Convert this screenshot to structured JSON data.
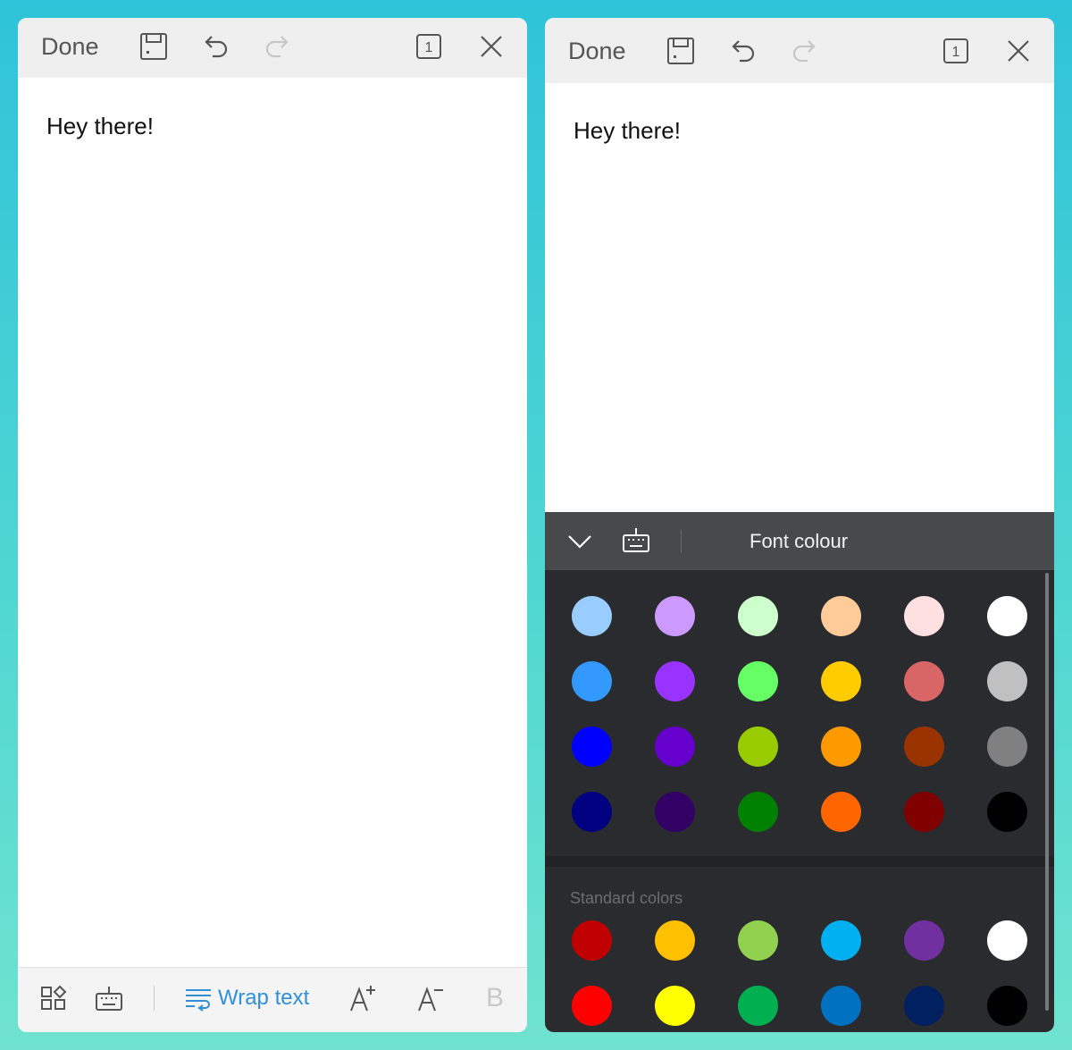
{
  "left_editor": {
    "toolbar": {
      "done_label": "Done",
      "page_number": "1"
    },
    "content_text": "Hey there!",
    "bottom_toolbar": {
      "wrap_text_label": "Wrap text",
      "bold_label": "B"
    }
  },
  "right_editor": {
    "toolbar": {
      "done_label": "Done",
      "page_number": "1"
    },
    "content_text": "Hey there!",
    "colour_sheet": {
      "title": "Font colour",
      "palette": [
        [
          "#99ccff",
          "#cc99ff",
          "#ccffcc",
          "#ffcc99",
          "#ffe0e0",
          "#ffffff"
        ],
        [
          "#3399ff",
          "#9933ff",
          "#66ff66",
          "#ffcc00",
          "#d96666",
          "#c0c0c0"
        ],
        [
          "#0000ff",
          "#6600cc",
          "#99cc00",
          "#ff9900",
          "#993300",
          "#808080"
        ],
        [
          "#000080",
          "#330066",
          "#008000",
          "#ff6600",
          "#800000",
          "#000000"
        ]
      ],
      "standard_label": "Standard colors",
      "standard_colors": [
        [
          "#c00000",
          "#ffc000",
          "#92d050",
          "#00b0f0",
          "#7030a0",
          "#ffffff"
        ],
        [
          "#ff0000",
          "#ffff00",
          "#00b050",
          "#0070c0",
          "#002060",
          "#000000"
        ]
      ]
    }
  }
}
